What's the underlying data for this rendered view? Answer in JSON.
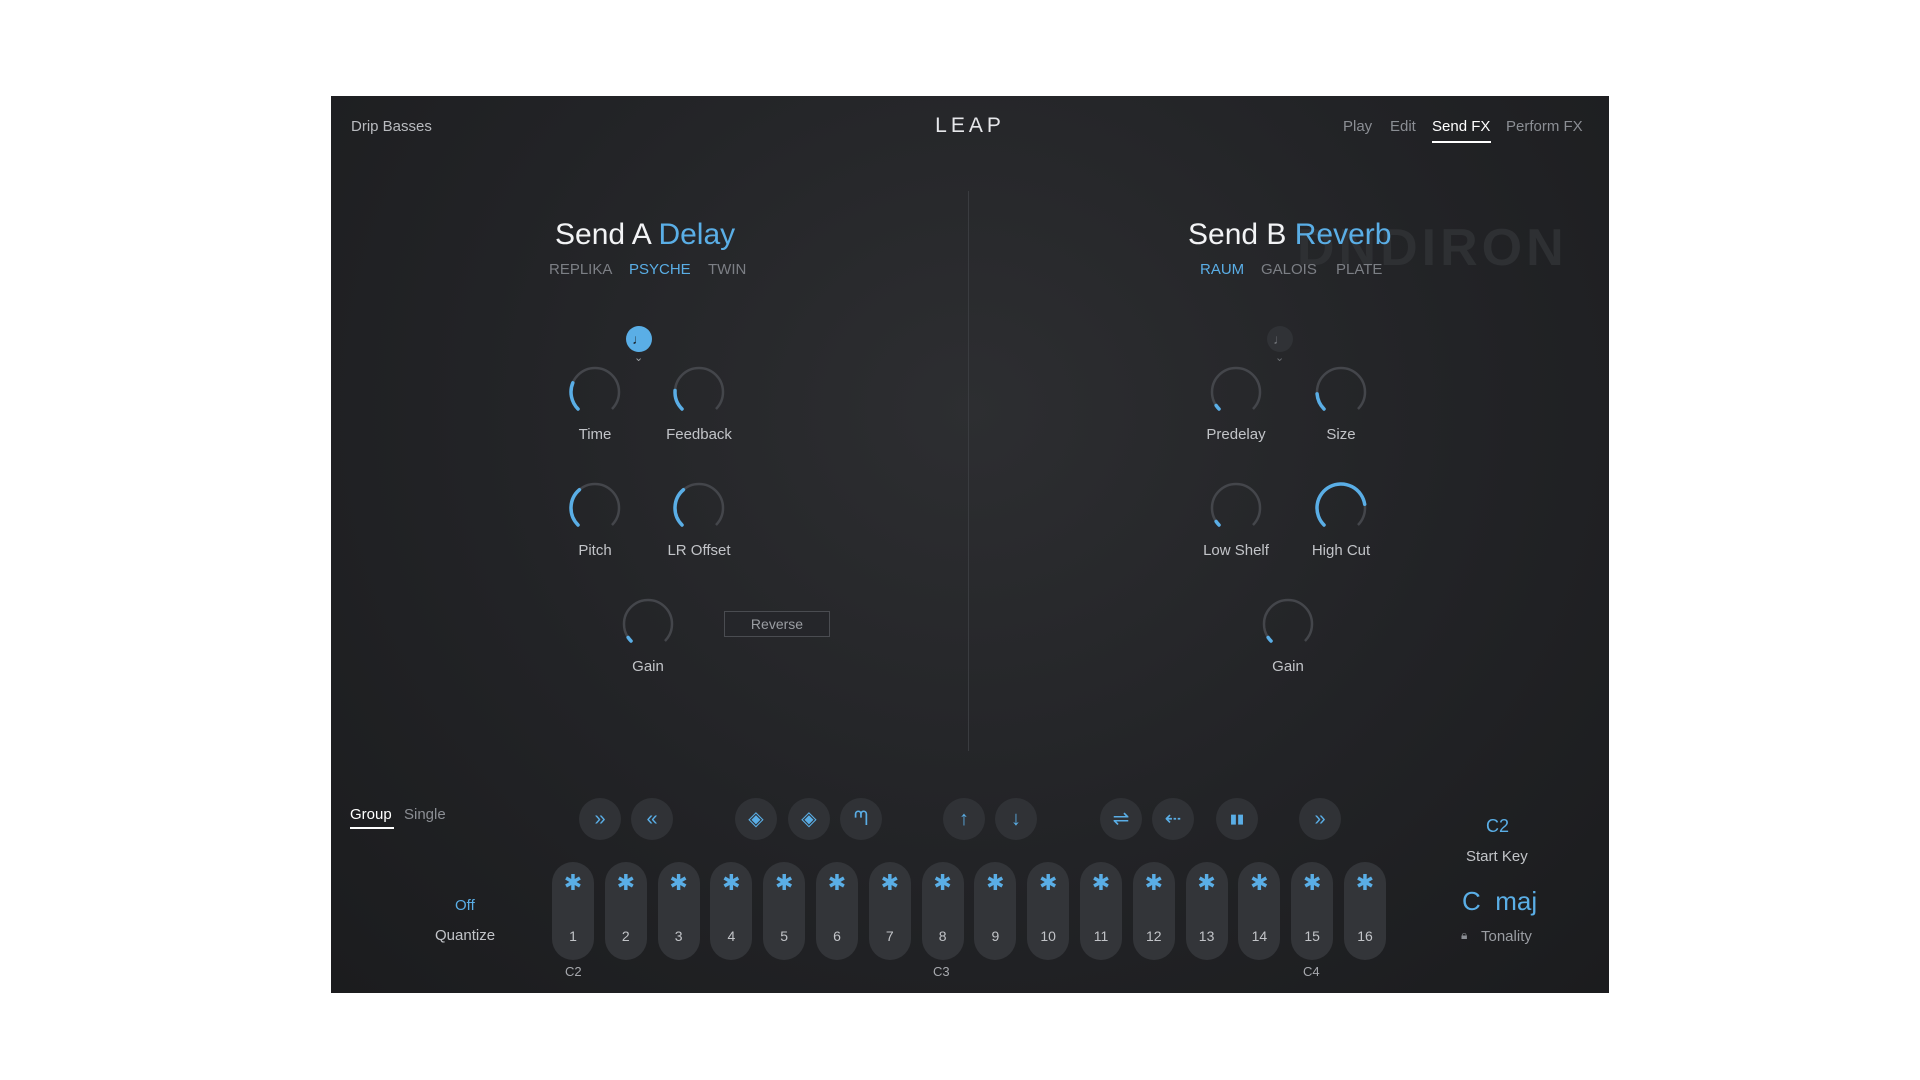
{
  "header": {
    "preset_name": "Drip Basses",
    "logo": "LEAP",
    "tabs": [
      {
        "label": "Play",
        "active": false
      },
      {
        "label": "Edit",
        "active": false
      },
      {
        "label": "Send FX",
        "active": true
      },
      {
        "label": "Perform FX",
        "active": false
      }
    ]
  },
  "watermark": "DNDIRON",
  "send_a": {
    "prefix": "Send A",
    "effect": "Delay",
    "variants": [
      {
        "label": "REPLIKA",
        "active": false
      },
      {
        "label": "PSYCHE",
        "active": true
      },
      {
        "label": "TWIN",
        "active": false
      }
    ],
    "sync_icon": "note-icon",
    "sync_active": true,
    "knobs": [
      {
        "label": "Time",
        "value": 0.25
      },
      {
        "label": "Feedback",
        "value": 0.18
      },
      {
        "label": "Pitch",
        "value": 0.35
      },
      {
        "label": "LR Offset",
        "value": 0.35
      },
      {
        "label": "Gain",
        "value": 0.04
      }
    ],
    "reverse_label": "Reverse"
  },
  "send_b": {
    "prefix": "Send B",
    "effect": "Reverb",
    "variants": [
      {
        "label": "RAUM",
        "active": true
      },
      {
        "label": "GALOIS",
        "active": false
      },
      {
        "label": "PLATE",
        "active": false
      }
    ],
    "sync_icon": "note-icon",
    "sync_active": false,
    "knobs": [
      {
        "label": "Predelay",
        "value": 0.04
      },
      {
        "label": "Size",
        "value": 0.15
      },
      {
        "label": "Low Shelf",
        "value": 0.04
      },
      {
        "label": "High Cut",
        "value": 0.8
      },
      {
        "label": "Gain",
        "value": 0.04
      }
    ]
  },
  "bottom": {
    "mode_tabs": [
      {
        "label": "Group",
        "active": true
      },
      {
        "label": "Single",
        "active": false
      }
    ],
    "quantize_value": "Off",
    "quantize_label": "Quantize",
    "tools": [
      {
        "icon": "double-chevron-right-icon",
        "glyph": "»"
      },
      {
        "icon": "double-chevron-left-icon",
        "glyph": "«"
      },
      {
        "icon": "pattern-diamond-icon",
        "glyph": "◈"
      },
      {
        "icon": "pattern-diamond-alt-icon",
        "glyph": "◈"
      },
      {
        "icon": "envelope-icon",
        "glyph": "ᘉ"
      },
      {
        "icon": "arrow-up-icon",
        "glyph": "↑"
      },
      {
        "icon": "arrow-down-icon",
        "glyph": "↓"
      },
      {
        "icon": "stretch-icon",
        "glyph": "⇌"
      },
      {
        "icon": "reverse-icon",
        "glyph": "⇠"
      },
      {
        "icon": "slices-icon",
        "glyph": "▮▮"
      },
      {
        "icon": "double-chevron-right-2-icon",
        "glyph": "»"
      }
    ],
    "pads": [
      "1",
      "2",
      "3",
      "4",
      "5",
      "6",
      "7",
      "8",
      "9",
      "10",
      "11",
      "12",
      "13",
      "14",
      "15",
      "16"
    ],
    "octave_labels": [
      "C2",
      "C3",
      "C4"
    ],
    "start_key_value": "C2",
    "start_key_label": "Start Key",
    "tonality_value": "C  maj",
    "tonality_label": "Tonality",
    "tonality_icon": "lock-icon"
  },
  "colors": {
    "accent": "#5aaee6",
    "panel": "#222326",
    "track": "#44464b"
  }
}
